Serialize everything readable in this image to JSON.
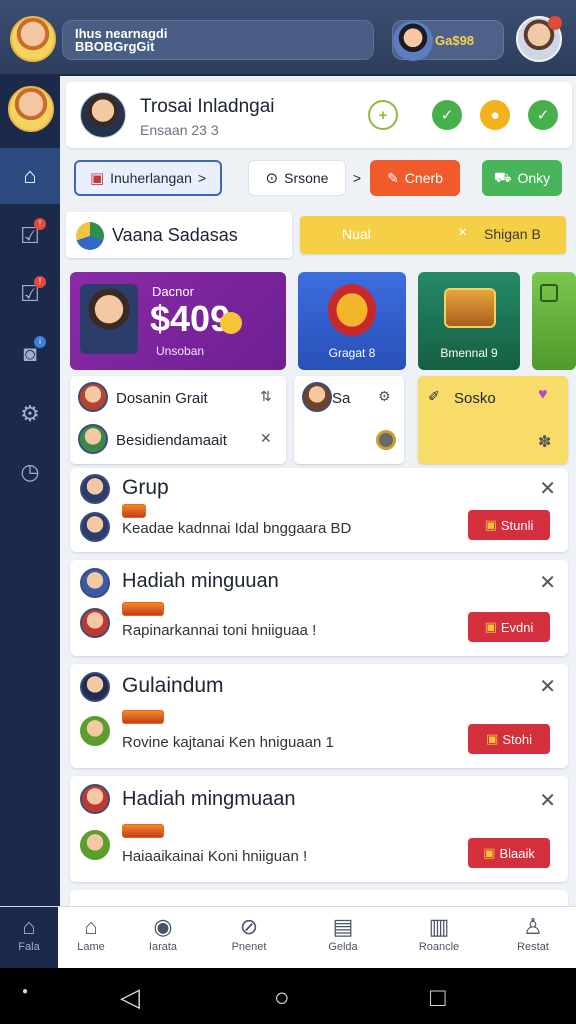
{
  "topbar": {
    "title_line1": "Ihus nearnagdi",
    "title_line2": "BBOBGrgGit",
    "coins": "Ga$98"
  },
  "rail": {
    "items": [
      {
        "icon": "home-icon",
        "badge": ""
      },
      {
        "icon": "check-box-icon",
        "badge": "!"
      },
      {
        "icon": "check-box-icon",
        "badge": "!"
      },
      {
        "icon": "camera-icon",
        "badge": "i"
      },
      {
        "icon": "gear-icon",
        "badge": ""
      },
      {
        "icon": "clock-icon",
        "badge": ""
      }
    ]
  },
  "profile": {
    "name": "Trosai Inladngai",
    "subtitle": "Ensaan 23 3"
  },
  "actions": {
    "primary": "Inuherlangan",
    "primary_arrow": ">",
    "search": "Srsone",
    "arrow": ">",
    "orange": "Cnerb",
    "green": "Onky"
  },
  "filter": {
    "label": "Vaana Sadasas"
  },
  "yellowbar": {
    "left": "Nual",
    "right": "Shigan B"
  },
  "tiles": [
    {
      "title": "Dacnor",
      "value": "$409",
      "caption": "Unsoban"
    },
    {
      "title": "",
      "value": "",
      "caption": "Gragat 8"
    },
    {
      "title": "",
      "value": "",
      "caption": "Bmennal 9"
    }
  ],
  "mini": {
    "a1": "Dosanin Grait",
    "a2": "Besidiendamaait",
    "b1": "Sa",
    "c1": "Sosko"
  },
  "groups": [
    {
      "title": "Grup",
      "message": "Keadae kadnnai Idal bnggaara BD",
      "action": "Stunli"
    },
    {
      "title": "Hadiah minguuan",
      "message": "Rapinarkannai toni hniiguaa !",
      "action": "Evdni"
    },
    {
      "title": "Gulaindum",
      "message": "Rovine kajtanai Ken hniguaan 1",
      "action": "Stohi"
    },
    {
      "title": "Hadiah mingmuaan",
      "message": "Haiaaikainai Koni hniiguan !",
      "action": "Blaaik"
    }
  ],
  "bottomnav": {
    "items": [
      "Fala",
      "Lame",
      "Iarata",
      "Pnenet",
      "Gelda",
      "Roancle",
      "Restat"
    ]
  },
  "colors": {
    "rail_bg": "#1b2a4a",
    "accent_blue": "#2c4a7f",
    "action_red": "#d32f3c",
    "orange": "#f15a2b",
    "green": "#48b55b",
    "yellow": "#f5cf45"
  }
}
